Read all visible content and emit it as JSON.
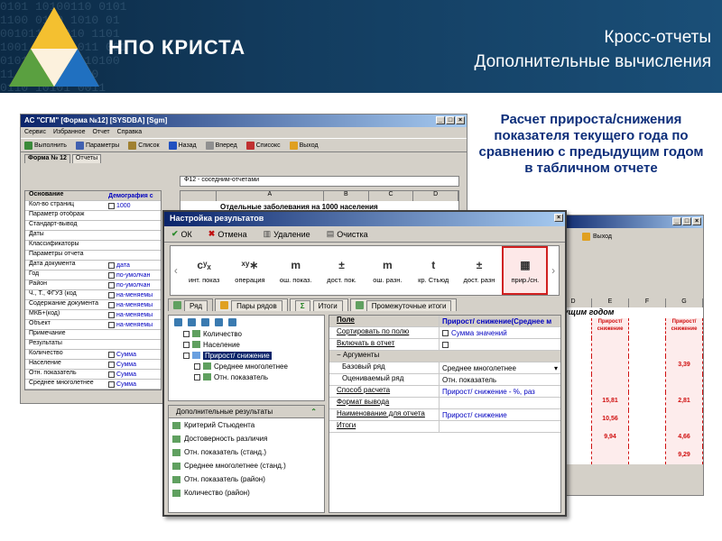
{
  "banner": {
    "binary_text": "0101 10100110 0101\n1100 0110 1010 01\n0010110 1010 1101\n1001 0100 1011 001\n010110 0110 10100\n11 0101 100110\n0110 10101 0011",
    "brand": "НПО КРИСТА",
    "title_line1": "Кросс-отчеты",
    "title_line2": "Дополнительные вычисления"
  },
  "description": "Расчет прироста/снижения показателя текущего года по сравнению с предыдущим годом в табличном отчете",
  "main_window": {
    "title": "АС \"СГМ\" [Форма №12] [SYSDBA] [Sgm]",
    "menu": [
      "Сервис",
      "Избранное",
      "Отчет",
      "Справка"
    ],
    "toolbar": [
      {
        "label": "Выполнить",
        "icon": "run-icon"
      },
      {
        "label": "Параметры",
        "icon": "params-icon"
      },
      {
        "label": "Список",
        "icon": "list-icon"
      },
      {
        "label": "Назад",
        "icon": "back-icon"
      },
      {
        "label": "Вперед",
        "icon": "forward-icon"
      },
      {
        "label": "Списокс",
        "icon": "list2-icon"
      },
      {
        "label": "Выход",
        "icon": "exit-icon"
      }
    ],
    "tabs": [
      "Форма № 12",
      "Отчеты"
    ],
    "sheet_selector": "Ф12 - соседним-отчетами",
    "grid_header": [
      "Основание",
      "Демография с"
    ],
    "grid_rows": [
      {
        "key": "Кол-во страниц",
        "value": "1000"
      },
      {
        "key": "Параметр отображ",
        "value": ""
      },
      {
        "key": "Стандарт-вывод",
        "value": ""
      },
      {
        "key": "Даты",
        "value": ""
      },
      {
        "key": "Классификаторы",
        "value": ""
      },
      {
        "key": "Параметры отчета",
        "value": ""
      },
      {
        "key": "Дата документа",
        "value": "дата"
      },
      {
        "key": "Год",
        "value": "по-умолчан"
      },
      {
        "key": "Район",
        "value": "по-умолчан"
      },
      {
        "key": "Ч., Т., ФГУЗ (код",
        "value": "на-меняемы"
      },
      {
        "key": "Содержание документа",
        "value": "на-меняемы"
      },
      {
        "key": "МКБ+(код)",
        "value": "на-меняемы"
      },
      {
        "key": "Объект",
        "value": "на-меняемы"
      },
      {
        "key": "Примечание",
        "value": ""
      },
      {
        "key": "Результаты",
        "value": ""
      },
      {
        "key": "Количество",
        "value": "Сумма"
      },
      {
        "key": "Население",
        "value": "Сумма"
      },
      {
        "key": "Отн. показатель",
        "value": "Сумма"
      },
      {
        "key": "Среднее многолетнее",
        "value": "Сумма"
      }
    ],
    "sheet_cols": [
      "A",
      "B",
      "C",
      "D"
    ],
    "sheet_caption": "Отдельные заболевания на 1000 населения"
  },
  "dialog": {
    "title": "Настройка результатов",
    "actions": [
      {
        "label": "ОК",
        "icon": "ok-check-icon"
      },
      {
        "label": "Отмена",
        "icon": "cancel-x-icon"
      },
      {
        "label": "Удаление",
        "icon": "trash-icon"
      },
      {
        "label": "Очистка",
        "icon": "clear-icon"
      }
    ],
    "calc_items": [
      {
        "label": "инт. показ",
        "sym": "cʸₓ"
      },
      {
        "label": "операция",
        "sym": "ˣʸ∗"
      },
      {
        "label": "ош. показ.",
        "sym": "m"
      },
      {
        "label": "дост. пок.",
        "sym": "±"
      },
      {
        "label": "ош. разн.",
        "sym": "m"
      },
      {
        "label": "кр. Стьюд",
        "sym": "t"
      },
      {
        "label": "дост. разн",
        "sym": "±"
      },
      {
        "label": "прир./сн.",
        "sym": "▦"
      }
    ],
    "tabs": [
      "Ряд",
      "Пары рядов",
      "Итоги",
      "Промежуточные итоги"
    ],
    "tree": [
      {
        "label": "Количество",
        "indent": 1
      },
      {
        "label": "Население",
        "indent": 1
      },
      {
        "label": "Прирост/ снижение",
        "indent": 1,
        "selected": true
      },
      {
        "label": "Среднее многолетнее",
        "indent": 2
      },
      {
        "label": "Отн. показатель",
        "indent": 2
      }
    ],
    "extra_header": "Дополнительные результаты",
    "extra_items": [
      "Критерий Стьюдента",
      "Достоверность различия",
      "Отн. показатель (станд.)",
      "Среднее многолетнее (станд.)",
      "Отн. показатель (район)",
      "Количество (район)"
    ],
    "props": [
      {
        "k": "Поле",
        "v": "Прирост/ снижение(Среднее м",
        "type": "head"
      },
      {
        "k": "Сортировать по полю",
        "v": "Сумма значений",
        "type": "normal"
      },
      {
        "k": "Включать в отчет",
        "v": "",
        "type": "normal"
      },
      {
        "k": "Аргументы",
        "v": "",
        "type": "group"
      },
      {
        "k": "Базовый ряд",
        "v": "Среднее многолетнее",
        "type": "sub-active"
      },
      {
        "k": "Оцениваемый ряд",
        "v": "Отн. показатель",
        "type": "sub"
      },
      {
        "k": "Способ расчета",
        "v": "Прирост/ снижение - %, раз",
        "type": "normal"
      },
      {
        "k": "Формат вывода",
        "v": "",
        "type": "normal"
      },
      {
        "k": "Наименование для отчета",
        "v": "Прирост/ снижение",
        "type": "normal"
      },
      {
        "k": "Итоги",
        "v": "",
        "type": "normal"
      }
    ]
  },
  "result_window": {
    "toolbar_exit": "Выход",
    "columns": [
      "D",
      "E",
      "F",
      "G"
    ],
    "caption": "дущим годом",
    "sub_headers": [
      "",
      "Прирост/снижение",
      "",
      "Прирост/снижение"
    ],
    "rows": [
      [
        "",
        "",
        "",
        ""
      ],
      [
        "",
        "",
        "",
        "3,39"
      ],
      [
        "",
        "",
        "",
        ""
      ],
      [
        "",
        "15,81",
        "",
        "2,81"
      ],
      [
        "",
        "10,56",
        "",
        ""
      ],
      [
        "",
        "9,94",
        "",
        "4,66"
      ],
      [
        "",
        "",
        "",
        "9,29"
      ]
    ]
  }
}
